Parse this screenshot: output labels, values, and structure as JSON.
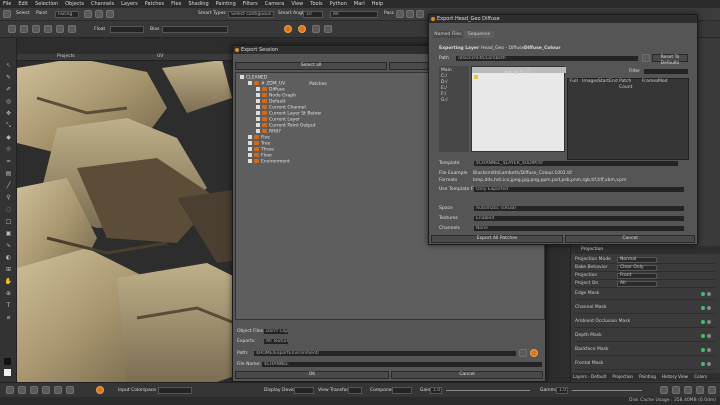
{
  "menu": [
    "File",
    "Edit",
    "Selection",
    "Objects",
    "Channels",
    "Layers",
    "Patches",
    "Flex",
    "Shading",
    "Painting",
    "Filters",
    "Camera",
    "View",
    "Tools",
    "Python",
    "Mari",
    "Help"
  ],
  "toolbar": {
    "select_label": "Select",
    "paint_label": "Paint",
    "painting_mode": "Facing",
    "smart_types_label": "Smart Types",
    "smart_types_value": "Select contiguous Shapes",
    "smart_angle_label": "Smart Angle",
    "smart_angle_value": "10",
    "all_value": "All",
    "size_label": "Size",
    "size_value": "Scale",
    "pass_label": "Pass",
    "float_label": "Float",
    "bias_label": "Bias"
  },
  "viewport": {
    "tab_projects": "Projects",
    "tab_uv": "UV"
  },
  "export_session": {
    "title": "Export Session",
    "select_all": "Select all",
    "select_none": "Select none",
    "tree": [
      {
        "label": "CLEANED",
        "level": 0
      },
      {
        "label": "# ZDM_UV",
        "level": 1,
        "suffix": "Patches"
      },
      {
        "label": "Diffuse",
        "level": 2
      },
      {
        "label": "Node Graph",
        "level": 2
      },
      {
        "label": "Default",
        "level": 2
      },
      {
        "label": "Current Channel",
        "level": 2
      },
      {
        "label": "Current Layer St Below",
        "level": 2
      },
      {
        "label": "Current Layer",
        "level": 2
      },
      {
        "label": "Current Paint Output",
        "level": 2
      },
      {
        "label": "RR87",
        "level": 2
      },
      {
        "label": "Five",
        "level": 1
      },
      {
        "label": "Tree",
        "level": 1
      },
      {
        "label": "Three",
        "level": 1
      },
      {
        "label": "Floor",
        "level": 1
      },
      {
        "label": "Environment",
        "level": 1
      }
    ],
    "object_files_label": "Object Files:",
    "object_files_value": "Don't Copy",
    "exports_label": "Exports:",
    "exports_value": "All Textures",
    "path_label": "Path:",
    "path_value": "$HOME/ExportEnvironment/",
    "file_name_label": "File Name:",
    "file_name_value": "$CHANNEL",
    "ok": "OK",
    "cancel": "Cancel"
  },
  "export_diffuse": {
    "title": "Export Head_Geo Diffuse",
    "tab_named": "Named Files",
    "tab_sequence": "Sequence",
    "exporting_layer_label": "Exporting Layer",
    "exporting_layer_prefix": "Head_Geo - Diffuse - ",
    "exporting_layer_name": "Diffuse_Colour",
    "path_label": "Path",
    "path_value": "/Blacksmith/Lambeth",
    "reset_defaults": "Reset To Defaults",
    "filter_label": "Filter",
    "drives": [
      "Main",
      "C:/",
      "D:/",
      "E:/",
      "F:/",
      "G:/"
    ],
    "columns": [
      "Full",
      "Images",
      "Start",
      "End",
      "Patch Count",
      "Frames",
      "Mod"
    ],
    "template_label": "Template",
    "template_value": "$CHANNEL_$LAYER_$UDIM.tif",
    "file_example_label": "File Example",
    "file_example_value": "Blacksmith/Lambeth/Diffuse_Colour.1001.tif",
    "formats_label": "Formats",
    "formats_value": "bmp,dds,hdr,ico,jpeg,jpg,png,ppm,psd,psb,pnm,rgb,tif,tiff,xbm,xpm",
    "use_template_label": "Use Template For",
    "use_template_value": "Only Exported",
    "colorspace_label": "Space",
    "colorspace_value": "Automatic (sRGB)",
    "textures_label": "Textures",
    "textures_value": "Enabled",
    "channels_label": "Channels",
    "channels_value": "None",
    "export_all": "Export All Patches",
    "cancel": "Cancel"
  },
  "right_panel": {
    "projection_header": "Projection",
    "rows": [
      {
        "label": "Projection Mode",
        "value": "Normal"
      },
      {
        "label": "Bake Behavior",
        "value": "Clear Only"
      },
      {
        "label": "Projection",
        "value": "Front"
      },
      {
        "label": "Project On",
        "value": "All"
      }
    ],
    "masks": [
      "Edge Mask",
      "Channel Mask",
      "Ambient Occlusion Mask",
      "Depth Mask",
      "Backface Mask",
      "Frontal Mask"
    ],
    "tabs": [
      "Layers - Default",
      "Projection",
      "Painting",
      "History View",
      "Colors"
    ]
  },
  "bottombar": {
    "input_colorspace": "Input Colorspace",
    "display_device": "Display Device",
    "view_transform": "View Transform",
    "component": "Component",
    "gain": "Gain",
    "gamma": "Gamma",
    "gain_value": "1.0",
    "gamma_value": "1.0"
  },
  "status": {
    "left": "",
    "right": "Disk Cache Usage : 358.40MB (0.0dm)"
  }
}
